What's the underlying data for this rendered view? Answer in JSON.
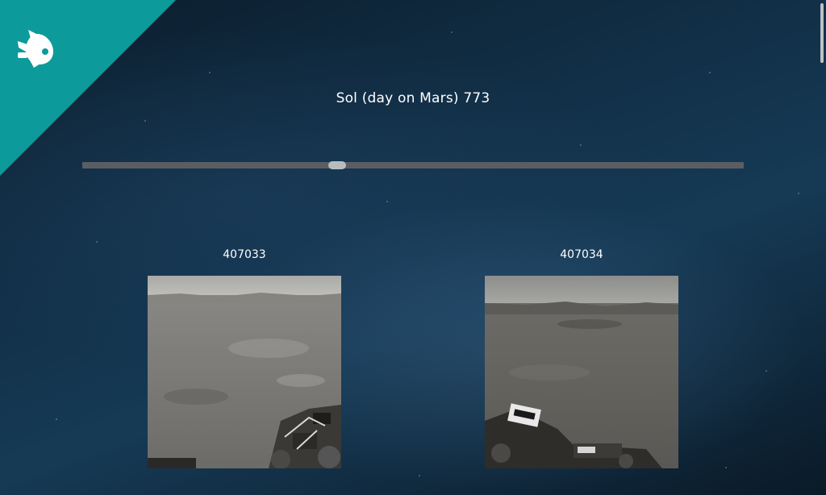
{
  "header": {
    "logo_icon": "rocket-icon",
    "accent_color": "#0d9a9a"
  },
  "sol": {
    "label": "Sol (day on Mars) 773",
    "slider_fraction": 0.385
  },
  "photos": [
    {
      "id": "407033"
    },
    {
      "id": "407034"
    }
  ]
}
